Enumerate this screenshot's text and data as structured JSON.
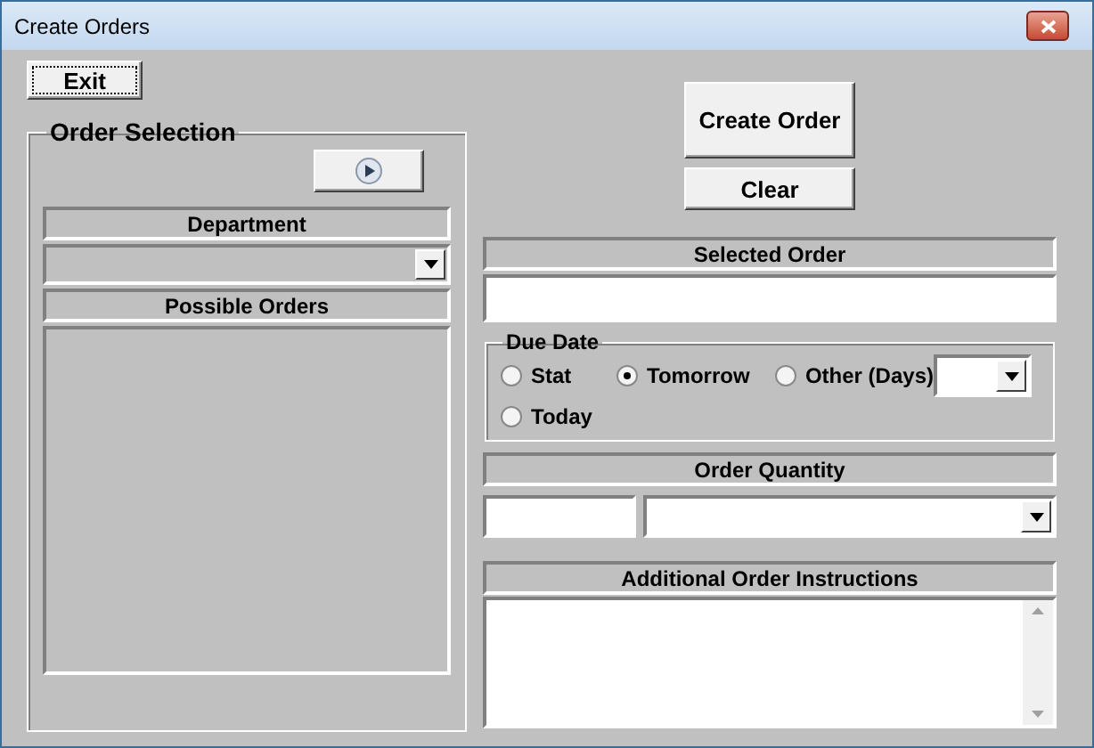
{
  "window": {
    "title": "Create Orders"
  },
  "exit_button": {
    "label": "Exit"
  },
  "order_selection": {
    "title": "Order Selection",
    "department": {
      "header": "Department"
    },
    "possible_orders": {
      "header": "Possible Orders"
    }
  },
  "create_order_button": {
    "label": "Create Order"
  },
  "clear_button": {
    "label": "Clear"
  },
  "selected_order": {
    "header": "Selected Order"
  },
  "due_date": {
    "title": "Due Date",
    "options": [
      {
        "label": "Stat",
        "selected": false
      },
      {
        "label": "Tomorrow",
        "selected": true
      },
      {
        "label": "Other (Days)",
        "selected": false
      },
      {
        "label": "Today",
        "selected": false
      }
    ]
  },
  "order_quantity": {
    "header": "Order Quantity"
  },
  "additional_instructions": {
    "header": "Additional Order Instructions"
  }
}
